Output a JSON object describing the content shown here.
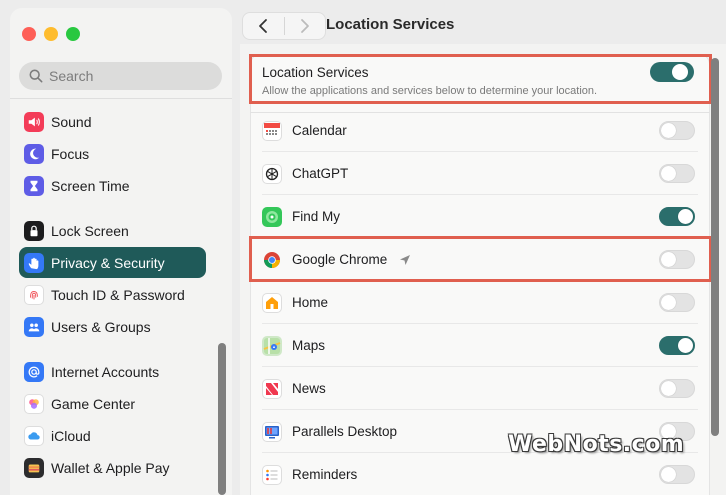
{
  "window": {
    "title": "Location Services"
  },
  "search": {
    "placeholder": "Search"
  },
  "sidebar": {
    "items": [
      {
        "label": "Sound",
        "icon": "speaker-icon",
        "color": "#f33c58"
      },
      {
        "label": "Focus",
        "icon": "moon-icon",
        "color": "#5e5ce6"
      },
      {
        "label": "Screen Time",
        "icon": "hourglass-icon",
        "color": "#5e5ce6"
      },
      {
        "label": "Lock Screen",
        "icon": "lock-icon",
        "color": "#1c1c1e"
      },
      {
        "label": "Privacy & Security",
        "icon": "hand-icon",
        "color": "#3478f6",
        "selected": true
      },
      {
        "label": "Touch ID & Password",
        "icon": "fingerprint-icon",
        "color": "#ffffff"
      },
      {
        "label": "Users & Groups",
        "icon": "users-icon",
        "color": "#3478f6"
      },
      {
        "label": "Internet Accounts",
        "icon": "at-icon",
        "color": "#3478f6"
      },
      {
        "label": "Game Center",
        "icon": "game-center-icon",
        "color": "#ffffff"
      },
      {
        "label": "iCloud",
        "icon": "cloud-icon",
        "color": "#ffffff"
      },
      {
        "label": "Wallet & Apple Pay",
        "icon": "wallet-icon",
        "color": "#1c1c1e"
      }
    ]
  },
  "location": {
    "title": "Location Services",
    "description": "Allow the applications and services below to determine your location.",
    "enabled": true
  },
  "apps": [
    {
      "name": "Calendar",
      "icon": "calendar-icon",
      "enabled": false
    },
    {
      "name": "ChatGPT",
      "icon": "chatgpt-icon",
      "enabled": false
    },
    {
      "name": "Find My",
      "icon": "find-my-icon",
      "enabled": true
    },
    {
      "name": "Google Chrome",
      "icon": "chrome-icon",
      "enabled": false,
      "recent_use_arrow": true
    },
    {
      "name": "Home",
      "icon": "home-icon",
      "enabled": false
    },
    {
      "name": "Maps",
      "icon": "maps-icon",
      "enabled": true
    },
    {
      "name": "News",
      "icon": "news-icon",
      "enabled": false
    },
    {
      "name": "Parallels Desktop",
      "icon": "parallels-icon",
      "enabled": false
    },
    {
      "name": "Reminders",
      "icon": "reminders-icon",
      "enabled": false
    }
  ],
  "colors": {
    "accent": "#2b6e6c",
    "selected_sidebar": "#1f5a59",
    "highlight": "#e05f4f"
  },
  "watermark": "WebNots.com"
}
